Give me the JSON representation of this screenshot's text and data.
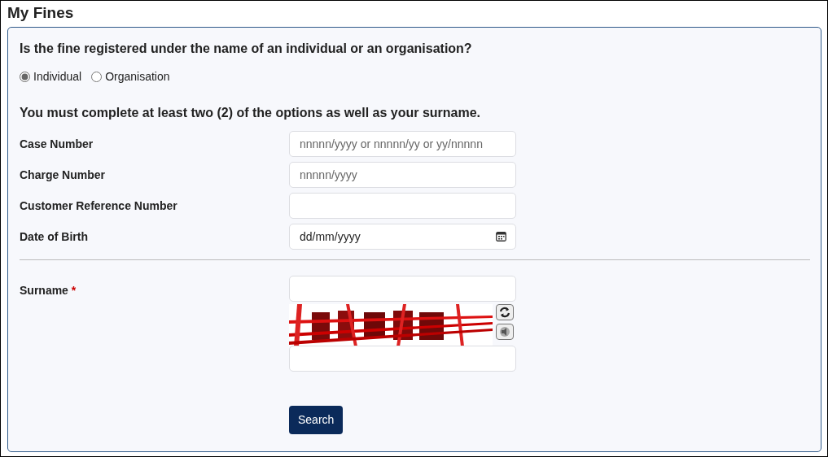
{
  "title": "My Fines",
  "question": "Is the fine registered under the name of an individual or an organisation?",
  "registrant_types": [
    {
      "label": "Individual",
      "selected": true
    },
    {
      "label": "Organisation",
      "selected": false
    }
  ],
  "instruction": "You must complete at least two (2) of the options as well as your surname.",
  "fields": [
    {
      "label": "Case Number",
      "placeholder": "nnnnn/yyyy or nnnnn/yy or yy/nnnnn",
      "kind": "text"
    },
    {
      "label": "Charge Number",
      "placeholder": "nnnnn/yyyy",
      "kind": "text"
    },
    {
      "label": "Customer Reference Number",
      "kind": "text"
    },
    {
      "label": "Date of Birth",
      "placeholder": "dd/mm/yyyy",
      "kind": "date"
    }
  ],
  "surname": {
    "label": "Surname",
    "required_mark": "*"
  },
  "search_button": "Search"
}
